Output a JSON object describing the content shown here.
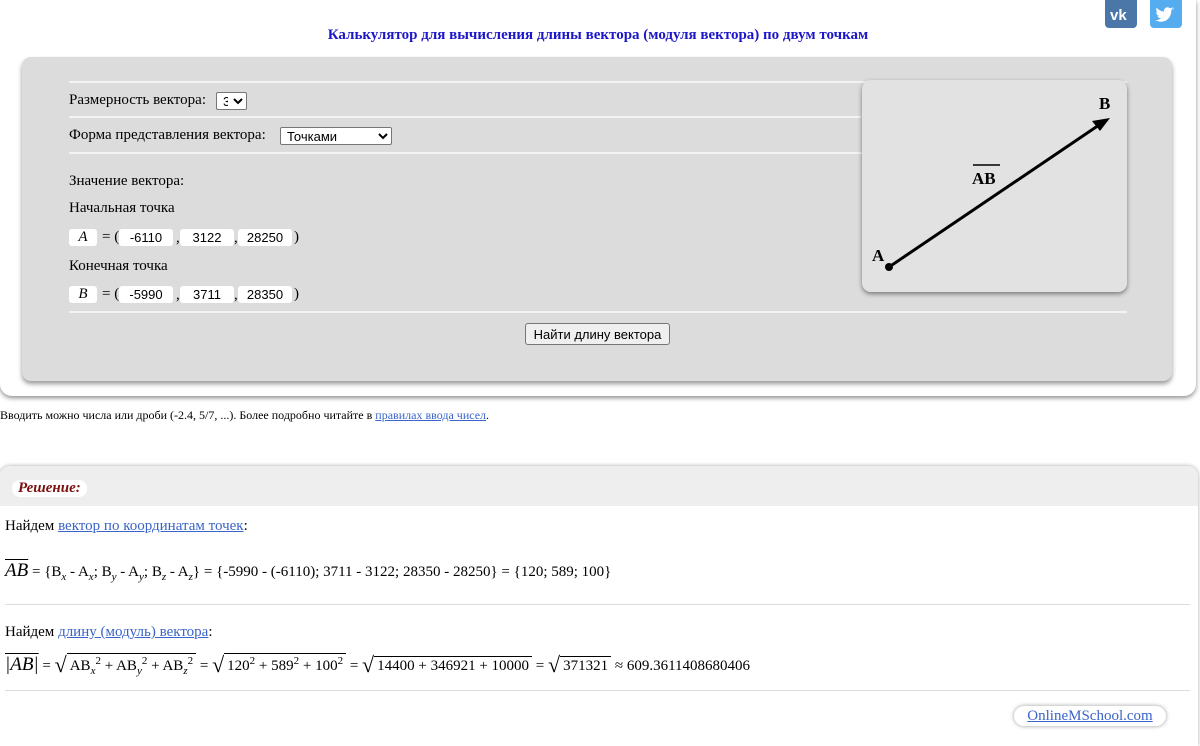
{
  "header": {
    "title": "Калькулятор для вычисления длины вектора (модуля вектора) по двум точкам"
  },
  "social": {
    "vk_icon": "vk-icon",
    "twitter_icon": "twitter-icon",
    "vk_color": "#4a76a8",
    "twitter_color": "#55acee"
  },
  "form": {
    "dimension_label": "Размерность вектора:",
    "dimension_value": "3",
    "representation_label": "Форма представления вектора:",
    "representation_value": "Точками",
    "value_label": "Значение вектора:",
    "start_label": "Начальная точка",
    "end_label": "Конечная точка",
    "point_a": {
      "name": "A",
      "x": "-6110",
      "y": "3122",
      "z": "28250"
    },
    "point_b": {
      "name": "B",
      "x": "-5990",
      "y": "3711",
      "z": "28350"
    },
    "eq": "= (",
    "comma": ",",
    "close": ")",
    "find_button": "Найти длину вектора"
  },
  "diagram": {
    "label_a": "A",
    "label_b": "B",
    "label_ab": "AB"
  },
  "hint": {
    "text": "Вводить можно числа или дроби (-2.4, 5/7, ...). Более подробно читайте в",
    "link": "правилах ввода чисел",
    "end": "."
  },
  "solution": {
    "title": "Решение:",
    "step1_text": "Найдем",
    "step1_link": "вектор по координатам точек",
    "step1_end": ":",
    "step1_formula": {
      "ab": "AB",
      "eq": "=",
      "lhs": "{B",
      "bx": "x",
      "minus1": " - A",
      "ax": "x",
      "sep1": "; B",
      "by": "y",
      "minus2": " - A",
      "ay": "y",
      "sep2": "; B",
      "bz": "z",
      "minus3": " - A",
      "az": "z",
      "rb": "}",
      "substituted": "= {-5990 - (-6110); 3711 - 3122; 28350 - 28250}",
      "result": "= {120; 589; 100}"
    },
    "step2_text": "Найдем",
    "step2_link": "длину (модуль) вектора",
    "step2_end": ":",
    "step2_formula": {
      "lhs": "|AB|",
      "eq": "=",
      "sym": "AB",
      "sx": "x",
      "sy": "y",
      "sz": "z",
      "pow": "2",
      "plus": " + ",
      "eq2": "=",
      "n1": "120",
      "n2": "589",
      "n3": "100",
      "eq3": "=",
      "sum": "14400 + 346921 + 10000",
      "eq4": "=",
      "total": "371321",
      "approx": "≈ 609.3611408680406"
    }
  },
  "brand": "OnlineMSchool.com"
}
